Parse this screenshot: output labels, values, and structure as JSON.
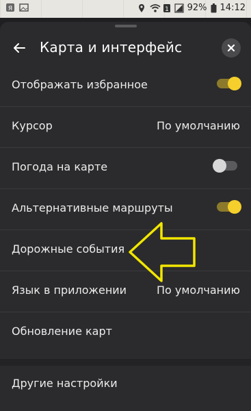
{
  "status_bar": {
    "battery": "92%",
    "time": "14:12",
    "sim_badge": "1"
  },
  "header": {
    "title": "Карта и интерфейс",
    "back_icon": "arrow-left-icon",
    "close_icon": "close-icon"
  },
  "settings": [
    {
      "label": "Отображать избранное",
      "type": "toggle",
      "on": true
    },
    {
      "label": "Курсор",
      "type": "value",
      "value": "По умолчанию"
    },
    {
      "label": "Погода на карте",
      "type": "toggle",
      "on": false
    },
    {
      "label": "Альтернативные маршруты",
      "type": "toggle",
      "on": true
    },
    {
      "label": "Дорожные события",
      "type": "link"
    },
    {
      "label": "Язык в приложении",
      "type": "value",
      "value": "По умолчанию"
    },
    {
      "label": "Обновление карт",
      "type": "link"
    }
  ],
  "other": {
    "label": "Другие настройки"
  },
  "colors": {
    "toggle_on": "#f5cf2b",
    "annotation_arrow": "#f2e600",
    "sheet_bg": "#2b2b2d"
  }
}
